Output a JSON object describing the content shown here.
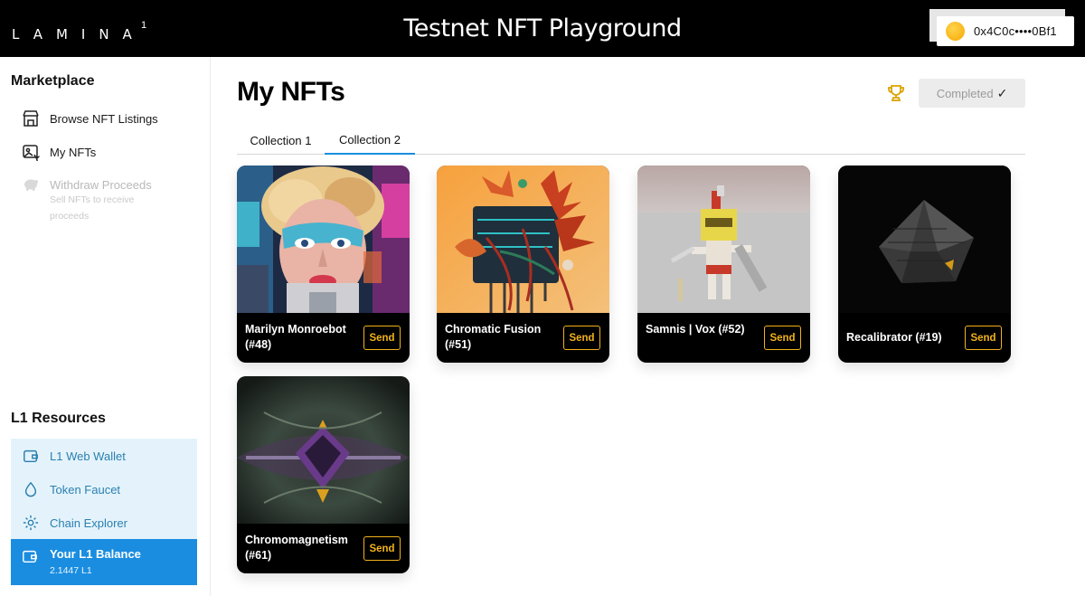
{
  "header": {
    "logo": "LAMINA",
    "logo_superscript": "1",
    "title": "Testnet NFT Playground",
    "wallet_address": "0x4C0c••••0Bf1"
  },
  "sidebar": {
    "marketplace_heading": "Marketplace",
    "items": [
      {
        "label": "Browse NFT Listings",
        "icon": "storefront-icon"
      },
      {
        "label": "My NFTs",
        "icon": "nft-image-icon"
      },
      {
        "label": "Withdraw Proceeds",
        "icon": "piggy-bank-icon",
        "subtext": "Sell NFTs to receive proceeds",
        "disabled": true
      }
    ],
    "resources_heading": "L1 Resources",
    "resources": [
      {
        "label": "L1 Web Wallet",
        "icon": "wallet-icon"
      },
      {
        "label": "Token Faucet",
        "icon": "droplet-icon"
      },
      {
        "label": "Chain Explorer",
        "icon": "explorer-icon"
      }
    ],
    "balance": {
      "title": "Your L1 Balance",
      "amount": "2.1447 L1"
    }
  },
  "main": {
    "title": "My NFTs",
    "completed_label": "Completed",
    "completed_check": "✓",
    "tabs": [
      {
        "label": "Collection 1",
        "active": false
      },
      {
        "label": "Collection 2",
        "active": true
      }
    ],
    "send_label": "Send",
    "nfts": [
      {
        "name": "Marilyn Monroebot (#48)"
      },
      {
        "name": "Chromatic Fusion (#51)"
      },
      {
        "name": "Samnis | Vox (#52)"
      },
      {
        "name": "Recalibrator (#19)"
      },
      {
        "name": "Chromomagnetism (#61)"
      }
    ]
  },
  "colors": {
    "accent": "#1a8de0",
    "send": "#f2b21b",
    "resources_bg": "#e4f3fb",
    "topbar": "#000000"
  }
}
